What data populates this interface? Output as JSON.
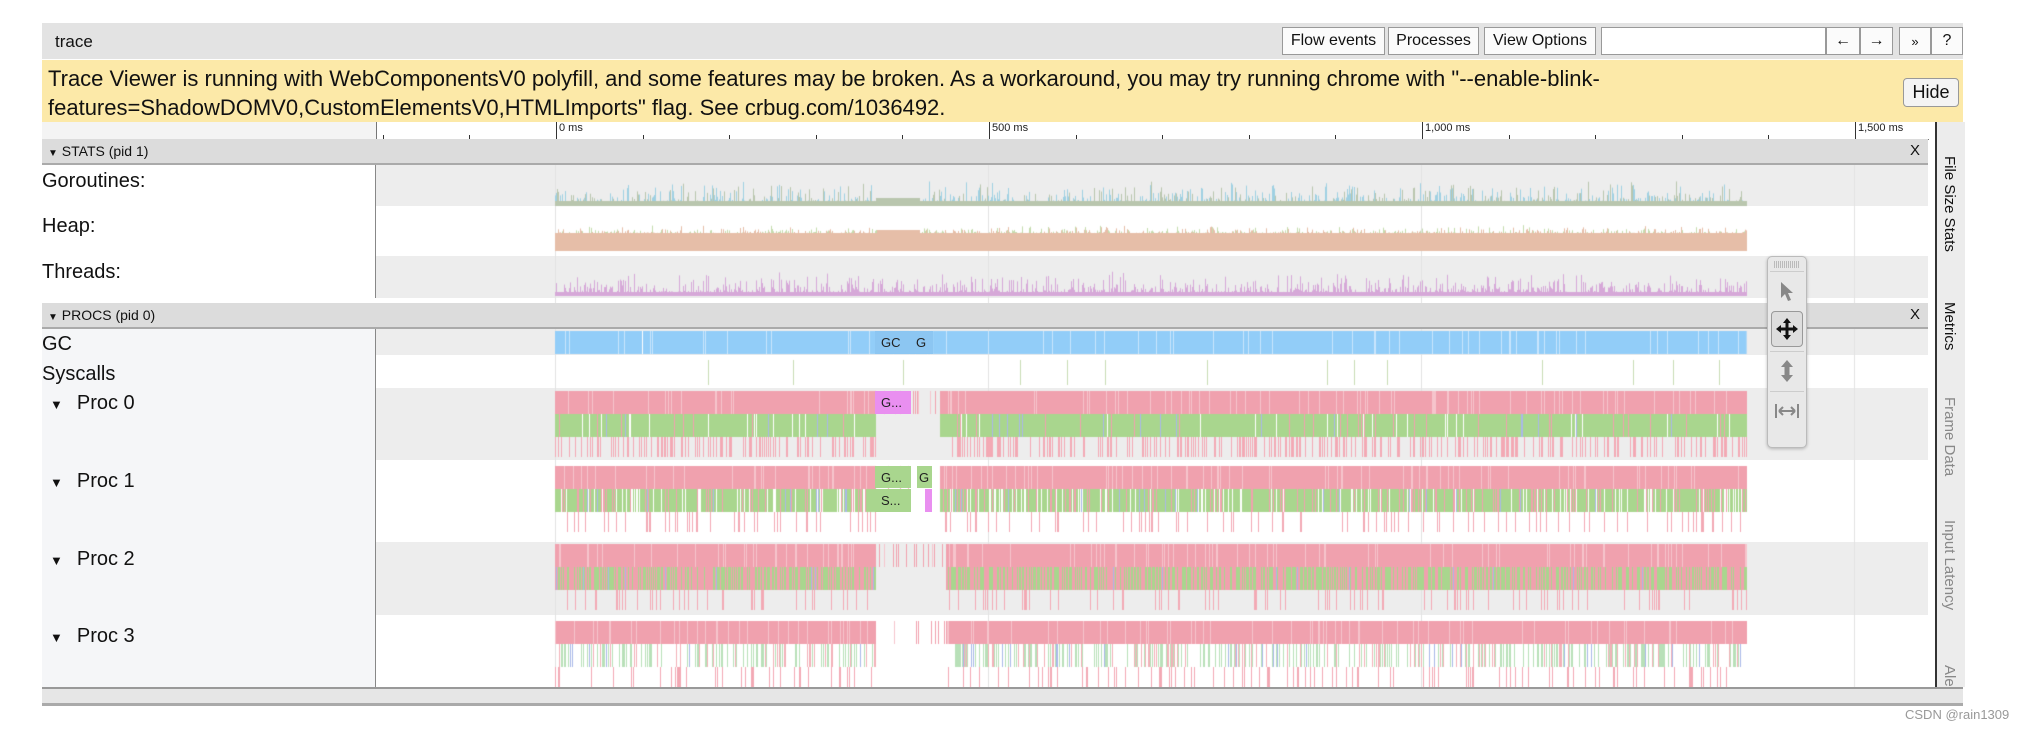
{
  "app": {
    "title": "trace"
  },
  "toolbar": {
    "flow_events": "Flow events",
    "processes": "Processes",
    "view_options": "View Options",
    "search_value": "",
    "prev": "←",
    "next": "→",
    "more": "»",
    "help": "?"
  },
  "banner": {
    "text": "Trace Viewer is running with WebComponentsV0 polyfill, and some features may be broken. As a workaround, you may try running chrome with \"--enable-blink-features=ShadowDOMV0,CustomElementsV0,HTMLImports\" flag. See crbug.com/1036492.",
    "hide": "Hide"
  },
  "ruler": {
    "labels": [
      "0 ms",
      "500 ms",
      "1,000 ms",
      "1,500 ms"
    ],
    "major_ms": [
      0,
      500,
      1000,
      1500
    ],
    "minor_step_ms": 100
  },
  "stats": {
    "header": "STATS (pid 1)",
    "close": "X",
    "tracks": [
      {
        "label": "Goroutines:"
      },
      {
        "label": "Heap:"
      },
      {
        "label": "Threads:"
      }
    ]
  },
  "procs": {
    "header": "PROCS (pid 0)",
    "close": "X",
    "gc": "GC",
    "syscalls": "Syscalls",
    "procs": [
      {
        "label": "Proc 0"
      },
      {
        "label": "Proc 1"
      },
      {
        "label": "Proc 2"
      },
      {
        "label": "Proc 3"
      }
    ],
    "slices": {
      "gc1": "GC",
      "gc2": "G",
      "p0": "G...",
      "p1a": "G...",
      "p1b": "S...",
      "p1c": "G"
    }
  },
  "trace_range_ms": [
    0,
    1376
  ],
  "colors": {
    "running": "#f0a1ae",
    "goroutine": "#a9d68e",
    "gc": "#92cdf8",
    "gc_mark": "#e98ff0",
    "heap": "#e6bea8",
    "threads": "#d6a8d8",
    "goroutines": "#9fd0e2"
  },
  "tool": {
    "items": [
      "grip",
      "select-icon",
      "pan-icon",
      "zoom-icon",
      "timing-icon"
    ],
    "selected": "pan-icon"
  },
  "sidebar": {
    "tabs": [
      "File Size Stats",
      "Metrics",
      "Frame Data",
      "Input Latency",
      "Ale"
    ]
  },
  "watermark": "CSDN @rain1309"
}
